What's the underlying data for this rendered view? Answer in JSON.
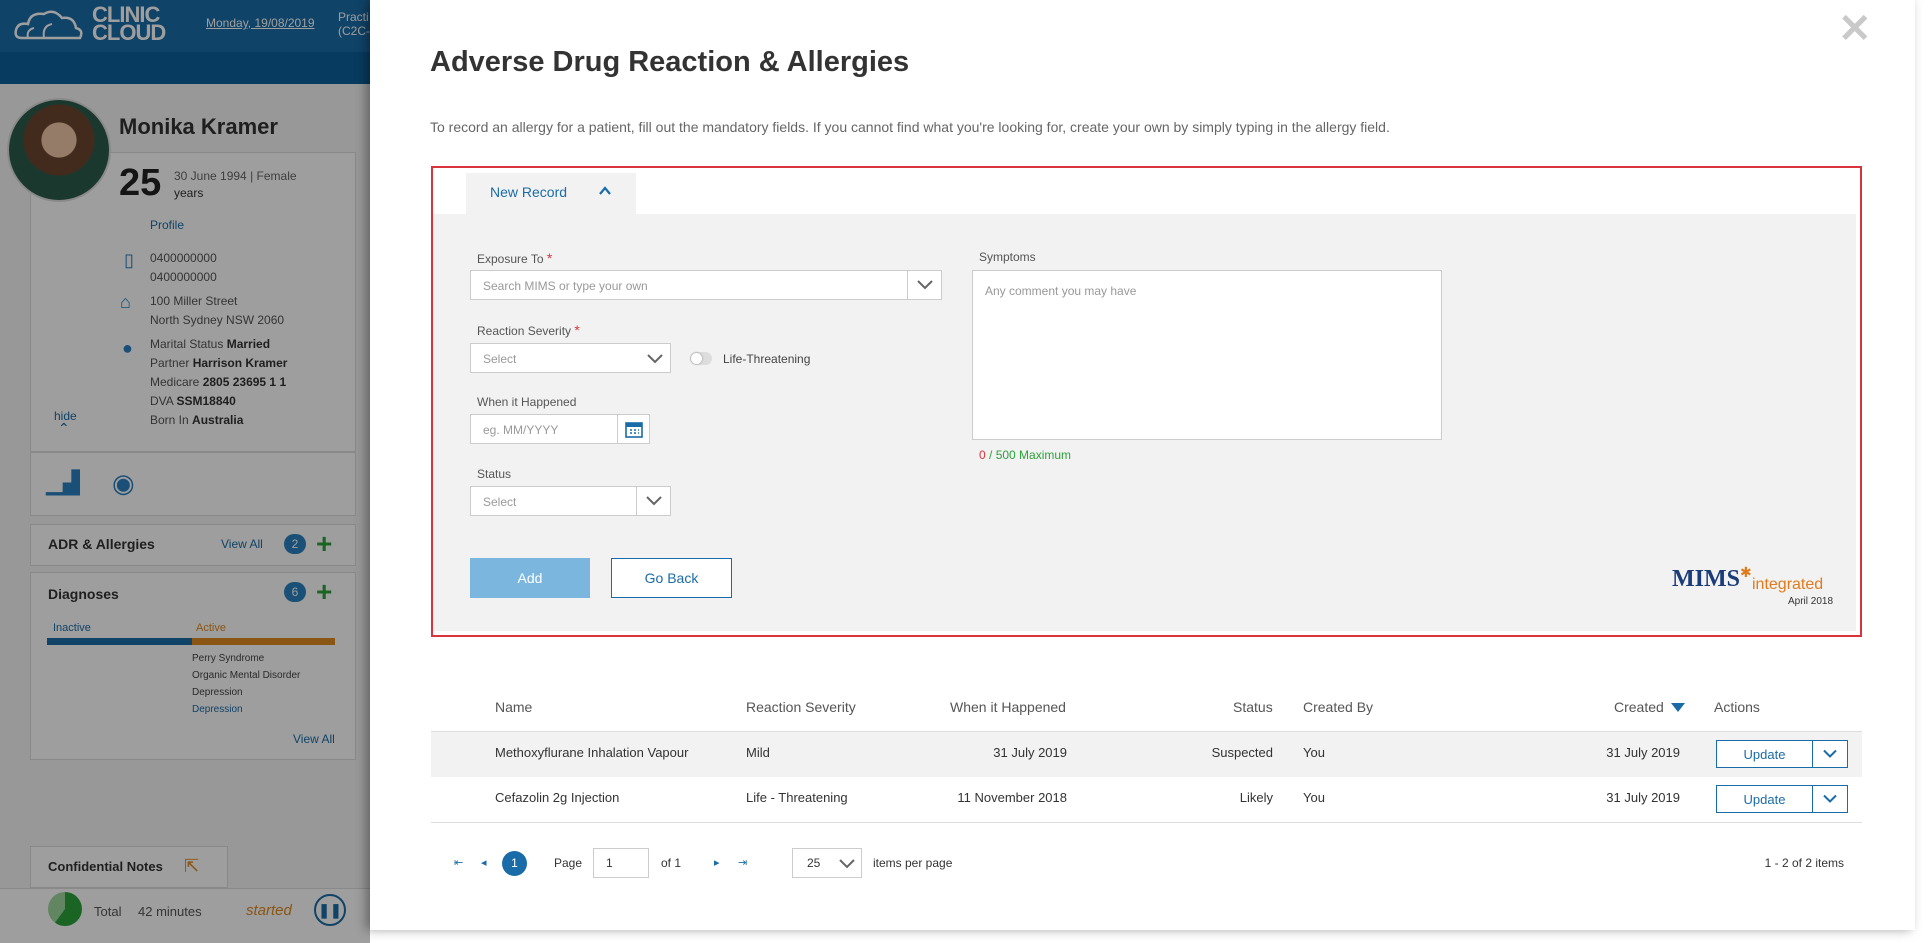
{
  "app": {
    "logo_text_1": "CLINIC",
    "logo_text_2": "CLOUD",
    "date": "Monday, 19/08/2019",
    "practice_line1": "Practi",
    "practice_line2": "(C2C-"
  },
  "patient": {
    "name": "Monika Kramer",
    "age": "25",
    "dob_gender": "30 June 1994 | Female",
    "years_label": "years",
    "profile_link": "Profile",
    "phone1": "0400000000",
    "phone2": "0400000000",
    "address1": "100 Miller Street",
    "address2": "North Sydney NSW 2060",
    "marital_label": "Marital Status",
    "marital_value": "Married",
    "partner_label": "Partner",
    "partner_value": "Harrison Kramer",
    "medicare_label": "Medicare",
    "medicare_value": "2805 23695 1 1",
    "dva_label": "DVA",
    "dva_value": "SSM18840",
    "born_label": "Born In",
    "born_value": "Australia",
    "hide_link": "hide"
  },
  "sidebar": {
    "adr_title": "ADR & Allergies",
    "adr_view_all": "View All",
    "adr_count": "2",
    "diag_title": "Diagnoses",
    "diag_count": "6",
    "inactive_label": "Inactive",
    "active_label": "Active",
    "diagnoses": [
      "Perry Syndrome",
      "Organic Mental Disorder",
      "Depression",
      "Depression"
    ],
    "diag_view_all": "View All",
    "conf_notes": "Confidential Notes",
    "timer_total_label": "Total",
    "timer_value": "42 minutes",
    "timer_status": "started"
  },
  "modal": {
    "title": "Adverse Drug Reaction & Allergies",
    "intro": "To record an allergy for a patient, fill out the mandatory fields. If you cannot find what you're looking for, create your own by simply typing in the allergy field.",
    "tab_label": "New Record",
    "exposure_label": "Exposure To",
    "exposure_placeholder": "Search MIMS or type your own",
    "severity_label": "Reaction Severity",
    "severity_placeholder": "Select",
    "life_threatening_label": "Life-Threatening",
    "when_label": "When it Happened",
    "when_placeholder": "eg. MM/YYYY",
    "status_label": "Status",
    "status_placeholder": "Select",
    "symptoms_label": "Symptoms",
    "symptoms_placeholder": "Any comment you may have",
    "counter_current": "0",
    "counter_max": "/ 500 Maximum",
    "required_mark": "*",
    "add_button": "Add",
    "back_button": "Go Back",
    "mims_brand": "MIMS",
    "mims_integrated": "integrated",
    "mims_date": "April 2018"
  },
  "table": {
    "headers": {
      "name": "Name",
      "severity": "Reaction Severity",
      "when": "When it Happened",
      "status": "Status",
      "created_by": "Created By",
      "created": "Created",
      "actions": "Actions"
    },
    "rows": [
      {
        "name": "Methoxyflurane Inhalation Vapour",
        "severity": "Mild",
        "when": "31 July 2019",
        "status": "Suspected",
        "created_by": "You",
        "created": "31 July 2019",
        "action": "Update"
      },
      {
        "name": "Cefazolin 2g Injection",
        "severity": "Life - Threatening",
        "when": "11 November 2018",
        "status": "Likely",
        "created_by": "You",
        "created": "31 July 2019",
        "action": "Update"
      }
    ]
  },
  "pager": {
    "current": "1",
    "page_label": "Page",
    "page_value": "1",
    "of_label": "of 1",
    "per_page": "25",
    "per_page_label": "items per page",
    "summary": "1 - 2 of 2 items"
  },
  "colors": {
    "brand_blue": "#1a6ca8",
    "highlight_red": "#d9333e",
    "add_button": "#7bb6df"
  }
}
